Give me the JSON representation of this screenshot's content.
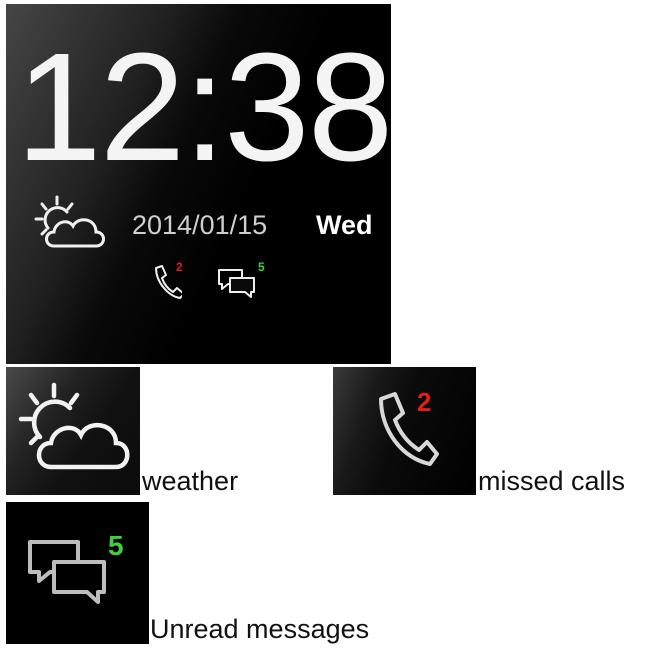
{
  "watch": {
    "time": "12:38",
    "date": "2014/01/15",
    "day": "Wed",
    "missed_calls": "2",
    "unread_messages": "5",
    "icons": [
      "weather-icon",
      "phone-icon",
      "message-icon"
    ]
  },
  "legend": {
    "weather_label": "weather",
    "calls_label": "missed calls",
    "messages_label": "Unread messages"
  },
  "colors": {
    "calls_badge": "#e41d1d",
    "messages_badge": "#3fcf3f",
    "icon_stroke": "#e8e8e8"
  }
}
